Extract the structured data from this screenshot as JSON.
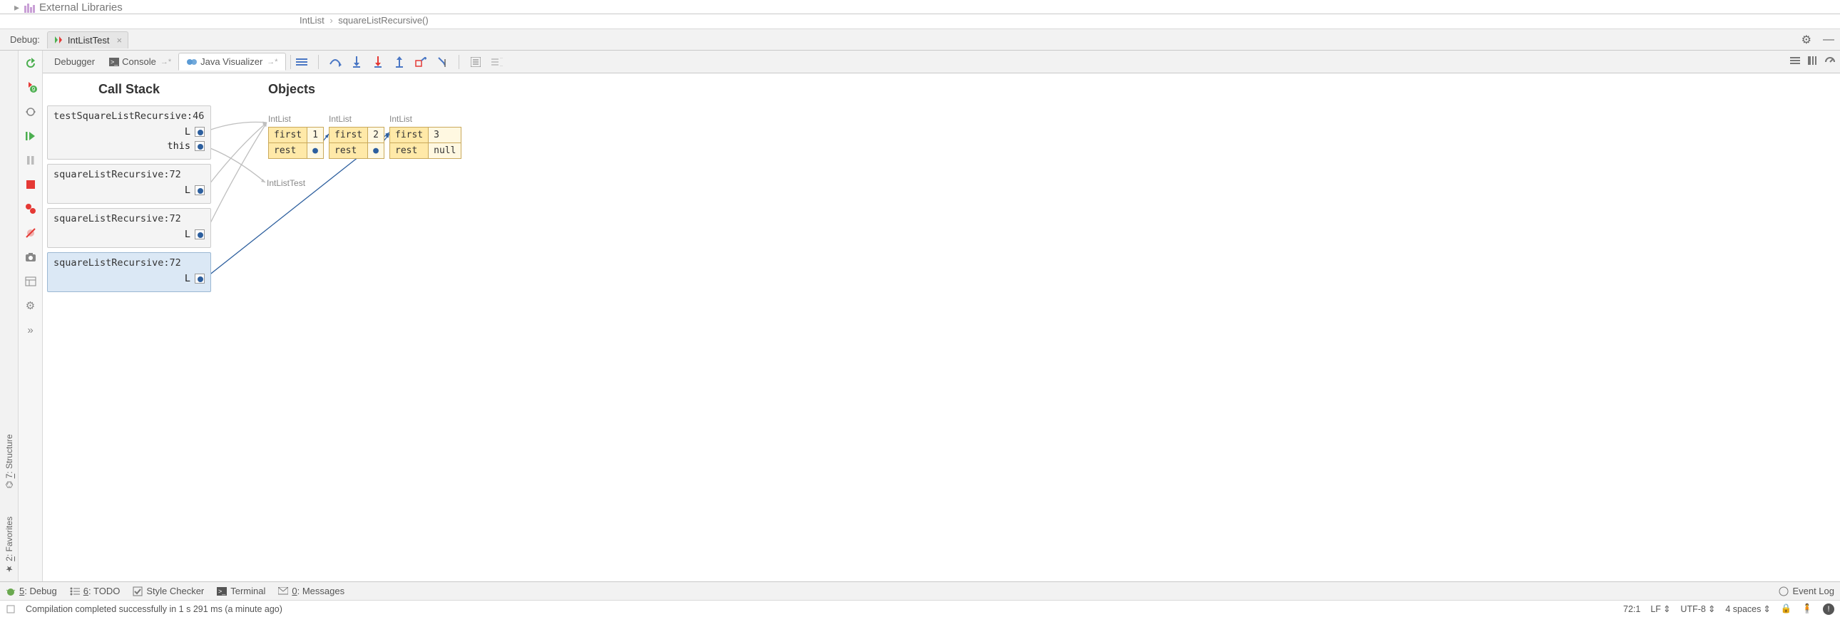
{
  "topFragment": {
    "chevron": "▸",
    "libIconColor": "#c9a0d6",
    "text": "External Libraries"
  },
  "breadcrumb": {
    "a": "IntList",
    "sep": "›",
    "b": "squareListRecursive()"
  },
  "debug": {
    "label": "Debug:",
    "tab": "IntListTest",
    "gear": "⚙",
    "min": "—"
  },
  "debugTabs": {
    "debugger": "Debugger",
    "console": "Console",
    "javaViz": "Java Visualizer"
  },
  "callStackHeader": "Call Stack",
  "objectsHeader": "Objects",
  "frames": [
    {
      "title": "testSquareListRecursive:46",
      "vars": [
        "L",
        "this"
      ],
      "selected": false
    },
    {
      "title": "squareListRecursive:72",
      "vars": [
        "L"
      ],
      "selected": false
    },
    {
      "title": "squareListRecursive:72",
      "vars": [
        "L"
      ],
      "selected": false
    },
    {
      "title": "squareListRecursive:72",
      "vars": [
        "L"
      ],
      "selected": true
    }
  ],
  "objects": {
    "typeLabel": "IntList",
    "testLabel": "IntListTest",
    "nodes": [
      {
        "first": "1",
        "rest": "●"
      },
      {
        "first": "2",
        "rest": "●"
      },
      {
        "first": "3",
        "rest": "null"
      }
    ],
    "fieldFirst": "first",
    "fieldRest": "rest"
  },
  "bottom": {
    "debug": "5: Debug",
    "todo": "6: TODO",
    "style": "Style Checker",
    "terminal": "Terminal",
    "messages": "0: Messages",
    "eventLog": "Event Log"
  },
  "status": {
    "msg": "Compilation completed successfully in 1 s 291 ms (a minute ago)",
    "pos": "72:1",
    "lf": "LF",
    "enc": "UTF-8",
    "indent": "4 spaces"
  },
  "sideTabs": {
    "structure": "7: Structure",
    "favorites": "2: Favorites"
  }
}
